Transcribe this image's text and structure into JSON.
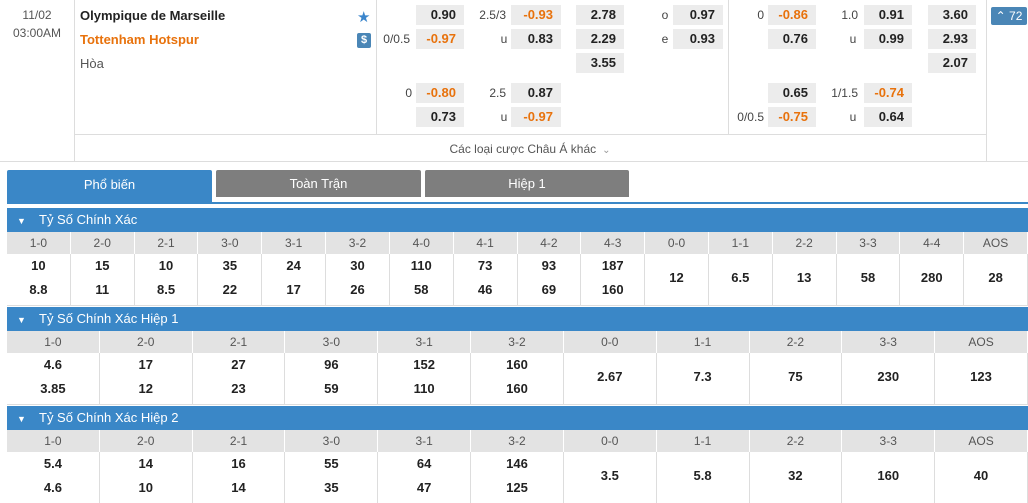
{
  "match": {
    "date": "11/02",
    "time": "03:00AM",
    "home": "Olympique de Marseille",
    "away": "Tottenham Hotspur",
    "draw": "Hòa",
    "more_bets": "Các loại cược Châu Á khác",
    "count_badge": "72",
    "ft": {
      "hdp": {
        "line_top": "",
        "line_bottom": "0/0.5",
        "home": "0.90",
        "away": "-0.97"
      },
      "ou": {
        "line": "2.5/3",
        "under_label": "u",
        "over": "-0.93",
        "under": "0.83"
      },
      "x12": {
        "home": "2.78",
        "away": "2.29",
        "draw": "3.55"
      },
      "oe": {
        "o_label": "o",
        "e_label": "e",
        "odd": "0.97",
        "even": "0.93"
      },
      "alt_hdp": {
        "line": "0",
        "home": "-0.80",
        "away": "0.73"
      },
      "alt_ou": {
        "line": "2.5",
        "under_label": "u",
        "over": "0.87",
        "under": "-0.97"
      }
    },
    "h1": {
      "hdp": {
        "line": "0",
        "home": "-0.86",
        "away": "0.76"
      },
      "ou": {
        "line": "1.0",
        "under_label": "u",
        "over": "0.91",
        "under": "0.99"
      },
      "x12": {
        "home": "3.60",
        "away": "2.93",
        "draw": "2.07"
      },
      "alt_hdp": {
        "line": "0/0.5",
        "home": "0.65",
        "away": "-0.75"
      },
      "alt_ou": {
        "line": "1/1.5",
        "under_label": "u",
        "over": "-0.74",
        "under": "0.64"
      }
    }
  },
  "tabs": [
    "Phổ biến",
    "Toàn Trận",
    "Hiệp 1"
  ],
  "sections": [
    {
      "title": "Tỷ Số Chính Xác",
      "columns": [
        "1-0",
        "2-0",
        "2-1",
        "3-0",
        "3-1",
        "3-2",
        "4-0",
        "4-1",
        "4-2",
        "4-3",
        "0-0",
        "1-1",
        "2-2",
        "3-3",
        "4-4",
        "AOS"
      ],
      "top": [
        "10",
        "15",
        "10",
        "35",
        "24",
        "30",
        "110",
        "73",
        "93",
        "187"
      ],
      "bottom": [
        "8.8",
        "11",
        "8.5",
        "22",
        "17",
        "26",
        "58",
        "46",
        "69",
        "160"
      ],
      "single": [
        "12",
        "6.5",
        "13",
        "58",
        "280",
        "28"
      ]
    },
    {
      "title": "Tỷ Số Chính Xác Hiệp 1",
      "columns": [
        "1-0",
        "2-0",
        "2-1",
        "3-0",
        "3-1",
        "3-2",
        "0-0",
        "1-1",
        "2-2",
        "3-3",
        "AOS"
      ],
      "top": [
        "4.6",
        "17",
        "27",
        "96",
        "152",
        "160"
      ],
      "bottom": [
        "3.85",
        "12",
        "23",
        "59",
        "110",
        "160"
      ],
      "single": [
        "2.67",
        "7.3",
        "75",
        "230",
        "123"
      ]
    },
    {
      "title": "Tỷ Số Chính Xác Hiệp 2",
      "columns": [
        "1-0",
        "2-0",
        "2-1",
        "3-0",
        "3-1",
        "3-2",
        "0-0",
        "1-1",
        "2-2",
        "3-3",
        "AOS"
      ],
      "top": [
        "5.4",
        "14",
        "16",
        "55",
        "64",
        "146"
      ],
      "bottom": [
        "4.6",
        "10",
        "14",
        "35",
        "47",
        "125"
      ],
      "single": [
        "3.5",
        "5.8",
        "32",
        "160",
        "40"
      ]
    }
  ],
  "colors": {
    "accent": "#3a87c7",
    "negative": "#e8720c",
    "tab_inactive": "#7e7e7e"
  },
  "icons": {
    "favorite": "star-icon",
    "money": "dollar-icon",
    "collapse": "chevron-down-icon"
  }
}
